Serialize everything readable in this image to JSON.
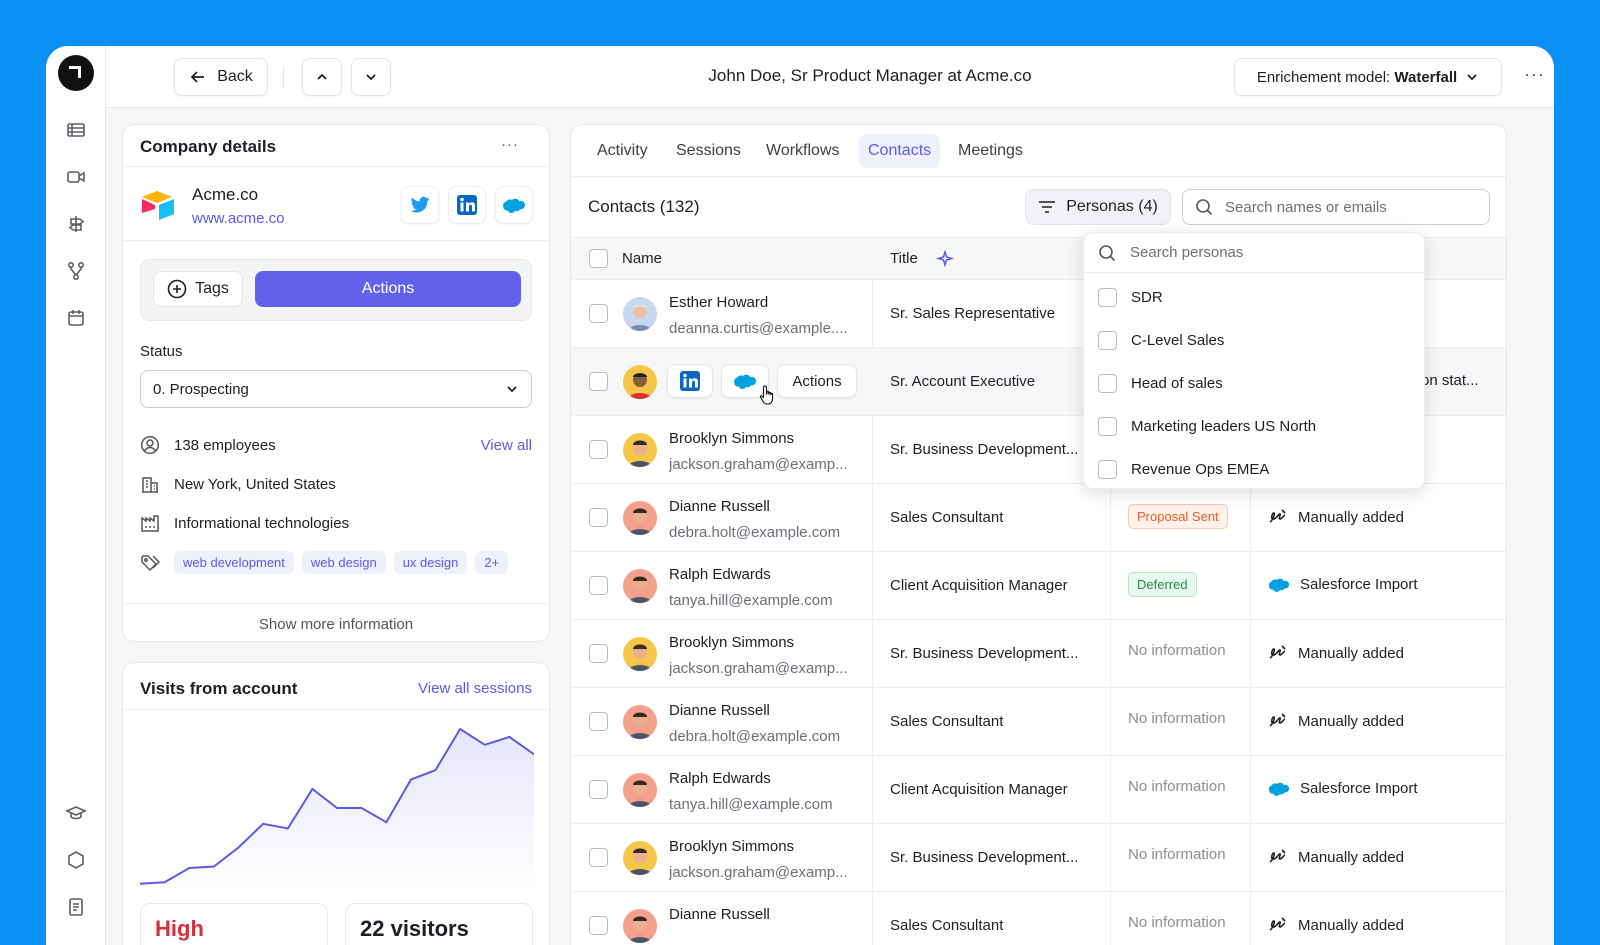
{
  "topbar": {
    "back_label": "Back",
    "title": "John Doe, Sr Product Manager at Acme.co",
    "enrich_prefix": "Enrichement model: ",
    "enrich_value": "Waterfall"
  },
  "company": {
    "header": "Company details",
    "name": "Acme.co",
    "url": "www.acme.co",
    "tags_label": "Tags",
    "actions_label": "Actions",
    "status_label": "Status",
    "status_value": "0. Prospecting",
    "employees": "138 employees",
    "view_all": "View all",
    "location": "New York, United States",
    "industry": "Informational technologies",
    "chips": [
      "web development",
      "web design",
      "ux design",
      "2+"
    ],
    "show_more": "Show more information"
  },
  "visits": {
    "title": "Visits from account",
    "link": "View all sessions",
    "stat1": "High",
    "stat2": "22 visitors",
    "series": [
      2,
      3,
      12,
      13,
      25,
      40,
      37,
      62,
      50,
      50,
      41,
      68,
      74,
      100,
      90,
      95,
      84
    ]
  },
  "tabs": [
    "Activity",
    "Sessions",
    "Workflows",
    "Contacts",
    "Meetings"
  ],
  "active_tab": "Contacts",
  "contacts": {
    "title": "Contacts (132)",
    "personas_label": "Personas (4)",
    "search_placeholder": "Search names or emails",
    "col_name": "Name",
    "col_title": "Title",
    "hover_actions": "Actions",
    "hover_truncated": "on stat...",
    "rows": [
      {
        "name": "Esther Howard",
        "email": "deanna.curtis@example....",
        "title": "Sr. Sales Representative",
        "status": "",
        "source": ""
      },
      {
        "name": "",
        "email": "",
        "title": "Sr. Account Executive",
        "status": "",
        "source": ""
      },
      {
        "name": "Brooklyn Simmons",
        "email": "jackson.graham@examp...",
        "title": "Sr. Business Development...",
        "status": "",
        "source": ""
      },
      {
        "name": "Dianne Russell",
        "email": "debra.holt@example.com",
        "title": "Sales Consultant",
        "status": "Proposal Sent",
        "source": "Manually added"
      },
      {
        "name": "Ralph Edwards",
        "email": "tanya.hill@example.com",
        "title": "Client Acquisition Manager",
        "status": "Deferred",
        "source": "Salesforce Import"
      },
      {
        "name": "Brooklyn Simmons",
        "email": "jackson.graham@examp...",
        "title": "Sr. Business Development...",
        "status": "No information",
        "source": "Manually added"
      },
      {
        "name": "Dianne Russell",
        "email": "debra.holt@example.com",
        "title": "Sales Consultant",
        "status": "No information",
        "source": "Manually added"
      },
      {
        "name": "Ralph Edwards",
        "email": "tanya.hill@example.com",
        "title": "Client Acquisition Manager",
        "status": "No information",
        "source": "Salesforce Import"
      },
      {
        "name": "Brooklyn Simmons",
        "email": "jackson.graham@examp...",
        "title": "Sr. Business Development...",
        "status": "No information",
        "source": "Manually added"
      },
      {
        "name": "Dianne Russell",
        "email": "",
        "title": "Sales Consultant",
        "status": "No information",
        "source": "Manually added"
      }
    ]
  },
  "personas_dropdown": {
    "search_placeholder": "Search personas",
    "items": [
      "SDR",
      "C-Level Sales",
      "Head of sales",
      "Marketing leaders US North",
      "Revenue Ops EMEA"
    ]
  },
  "colors": {
    "accent": "#6161ec",
    "link": "#5b5be8",
    "frame": "#0a8ff5"
  }
}
